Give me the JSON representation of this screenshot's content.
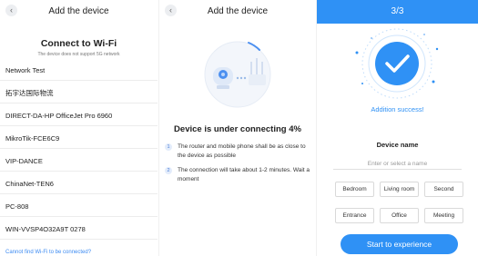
{
  "panel1": {
    "title": "Add the device",
    "back_icon": "chevron-left-icon",
    "heading": "Connect to Wi-Fi",
    "subheading": "The device does not support 5G network",
    "networks": [
      "Network Test",
      "拓宇达国际物流",
      "DIRECT-DA-HP OfficeJet Pro 6960",
      "MikroTik-FCE6C9",
      "VIP-DANCE",
      "ChinaNet-TEN6",
      "PC-808",
      "WIN-VVSP4O32A9T 0278"
    ],
    "cant_find_link": "Cannot find Wi-Fi to be connected?"
  },
  "panel2": {
    "title": "Add the device",
    "back_icon": "chevron-left-icon",
    "status": "Device is under connecting 4%",
    "progress_percent": 4,
    "tips": [
      {
        "num": "1",
        "text": "The router and mobile phone shall be as close to the device as possible"
      },
      {
        "num": "2",
        "text": "The connection will take about 1-2 minutes. Wait a moment"
      }
    ]
  },
  "panel3": {
    "title": "3/3",
    "success_text": "Addition success!",
    "device_name_label": "Device name",
    "device_name_placeholder": "Enter or select a name",
    "rooms": [
      "Bedroom",
      "Living room",
      "Second bedroom",
      "Entrance",
      "Office",
      "Meeting"
    ],
    "cta_label": "Start to experience",
    "colors": {
      "accent": "#2f91f5"
    }
  }
}
